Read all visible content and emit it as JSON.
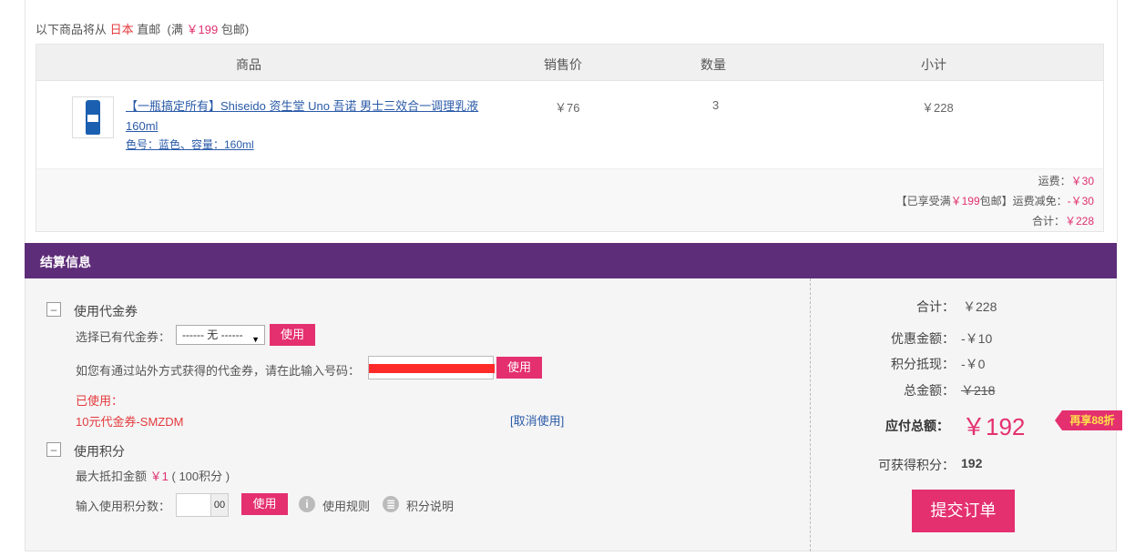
{
  "ship_note": {
    "prefix": "以下商品将从",
    "country": "日本",
    "middle": "直邮",
    "open": "(满",
    "threshold": "￥199",
    "close": "包邮)"
  },
  "table": {
    "headers": [
      "商品",
      "销售价",
      "数量",
      "小计"
    ],
    "rows": [
      {
        "name": "【一瓶搞定所有】Shiseido 资生堂 Uno 吾诺 男士三效合一调理乳液 160ml",
        "attrs": "色号：蓝色、容量：160ml",
        "price": "￥76",
        "qty": "3",
        "subtotal": "￥228"
      }
    ]
  },
  "summary": {
    "shipping_label": "运费：",
    "shipping_value": "￥30",
    "free_prefix": "【已享受满",
    "free_threshold": "￥199",
    "free_suffix": "包邮】运费减免：",
    "free_value": "-￥30",
    "total_label": "合计：",
    "total_value": "￥228"
  },
  "settle": {
    "title": "结算信息",
    "voucher": {
      "toggle": "–",
      "title": "使用代金券",
      "select_label": "选择已有代金券：",
      "select_value": "------ 无 ------",
      "use_label": "使用",
      "code_label": "如您有通过站外方式获得的代金券，请在此输入号码：",
      "code_use_label": "使用",
      "used_label": "已使用：",
      "used_item": "10元代金券-SMZDM",
      "cancel_label": "[取消使用]"
    },
    "points": {
      "toggle": "–",
      "title": "使用积分",
      "max_prefix": "最大抵扣金额",
      "max_amount": "￥1",
      "max_suffix": "( 100积分 )",
      "input_label": "输入使用积分数：",
      "input_suffix": "00",
      "use_label": "使用",
      "rules_icon": "i",
      "rules_label": "使用规则",
      "explain_icon": "≣",
      "explain_label": "积分说明"
    },
    "right": {
      "total_label": "合计：",
      "total_value": "￥228",
      "discount_label": "优惠金额：",
      "discount_value": "-￥10",
      "points_label": "积分抵现：",
      "points_value": "-￥0",
      "gross_label": "总金额：",
      "gross_value": "￥218",
      "pay_label": "应付总额：",
      "pay_value": "￥192",
      "badge": "再享88折",
      "earn_label": "可获得积分：",
      "earn_value": "192",
      "submit": "提交订单"
    }
  },
  "colors": {
    "accent": "#e4306f",
    "header_bar": "#5e2d79",
    "link": "#2a5aa8"
  }
}
